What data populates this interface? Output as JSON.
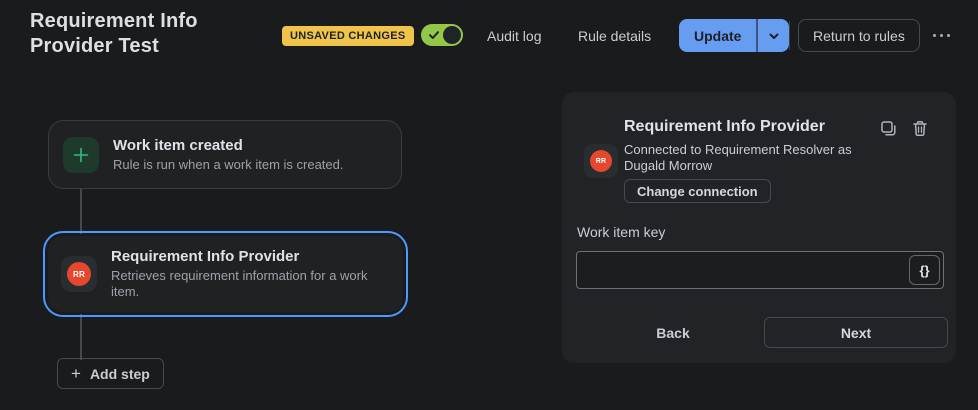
{
  "colors": {
    "background": "#1A1B1D",
    "panel_background": "#212326",
    "card_background": "#1F2123",
    "accent_blue": "#669DF1",
    "selection_blue": "#4C9AFF",
    "toggle_green": "#94C748",
    "trigger_green": "#37B981",
    "warning_yellow": "#F0C44B",
    "app_red": "#E5482F"
  },
  "header": {
    "title": "Requirement Info Provider Test",
    "unsaved_badge": "UNSAVED CHANGES",
    "toggle_state": "on",
    "audit_log": "Audit log",
    "rule_details": "Rule details",
    "update": "Update",
    "return_to_rules": "Return to rules"
  },
  "canvas": {
    "steps": [
      {
        "title": "Work item created",
        "description": "Rule is run when a work item is created.",
        "icon": "plus-trigger-icon",
        "selected": false
      },
      {
        "title": "Requirement Info Provider",
        "description": "Retrieves requirement information for a work item.",
        "icon": "rr-app-icon",
        "initials": "RR",
        "selected": true
      }
    ],
    "add_step": "Add step",
    "add_step_plus": "+"
  },
  "panel": {
    "title": "Requirement Info Provider",
    "avatar_initials": "RR",
    "connection_text": "Connected to Requirement Resolver as Dugald Morrow",
    "change_connection": "Change connection",
    "field_label": "Work item key",
    "field_value": "",
    "smart_value_button": "{}",
    "back": "Back",
    "next": "Next"
  }
}
